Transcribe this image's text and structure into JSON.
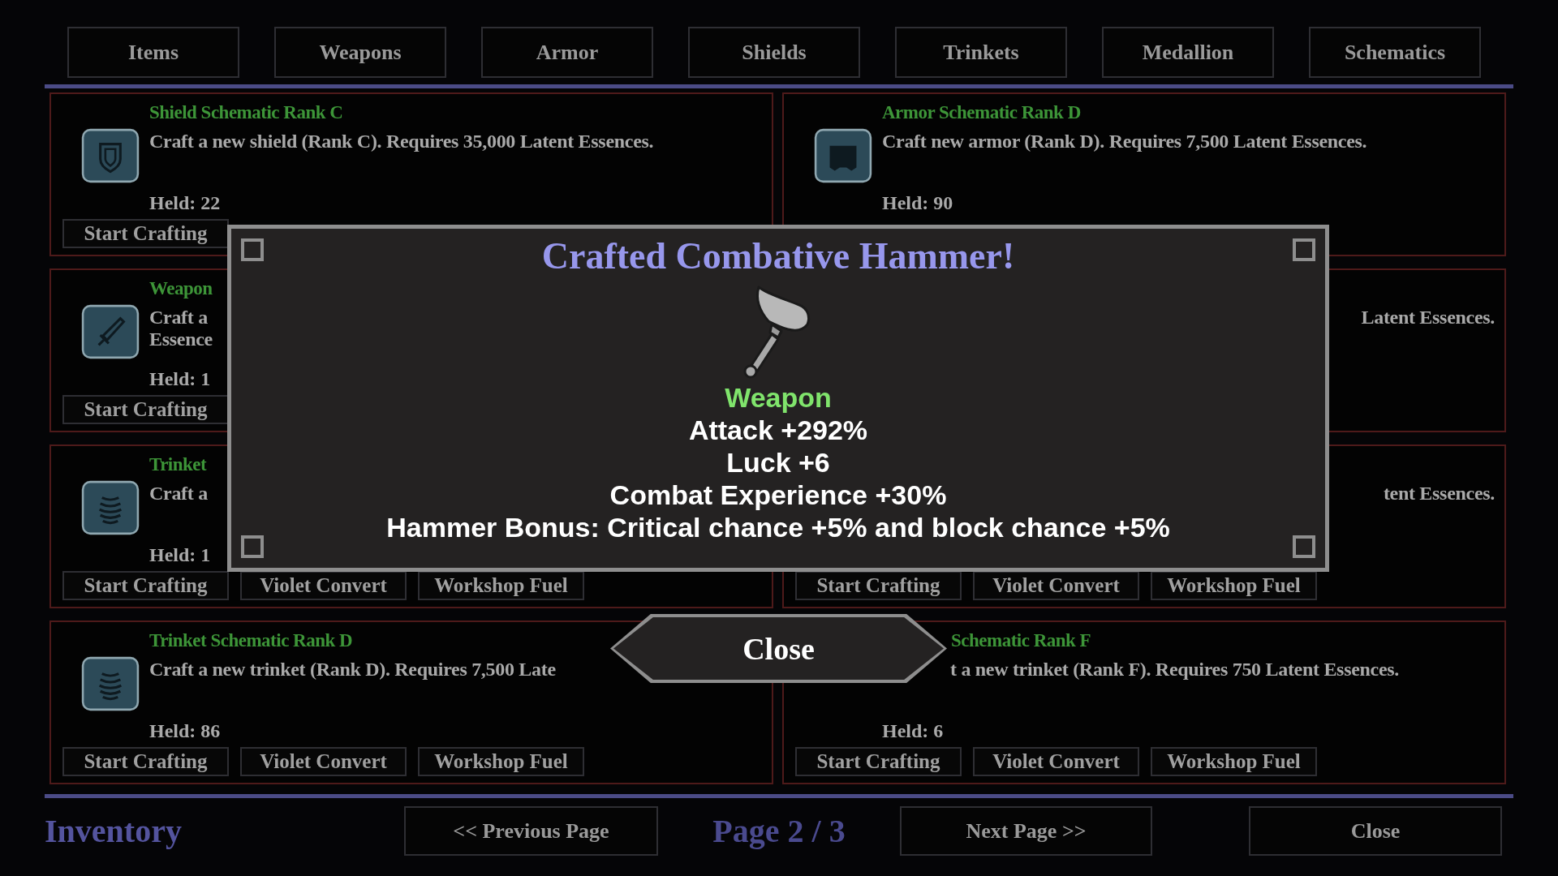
{
  "tabs": [
    {
      "label": "Items"
    },
    {
      "label": "Weapons"
    },
    {
      "label": "Armor"
    },
    {
      "label": "Shields"
    },
    {
      "label": "Trinkets"
    },
    {
      "label": "Medallion"
    },
    {
      "label": "Schematics"
    }
  ],
  "cards": [
    {
      "kind": "shield",
      "title": "Shield Schematic Rank C",
      "description": [
        "Craft a new shield (Rank C). Requires 35,000 Latent Essences."
      ],
      "held": "Held: 22",
      "buttons": [
        "Start Crafting"
      ]
    },
    {
      "kind": "armor",
      "title": "Armor Schematic Rank D",
      "description": [
        "Craft new armor (Rank D). Requires 7,500 Latent Essences."
      ],
      "held": "Held: 90"
    },
    {
      "kind": "sword",
      "title": "Weapon",
      "description": [
        "Craft a",
        "Essence"
      ],
      "held": "Held: 1",
      "buttons": [
        "Start Crafting"
      ]
    },
    {
      "description": [
        "Latent Essences."
      ]
    },
    {
      "kind": "coil",
      "title": "Trinket",
      "description": [
        "Craft a"
      ],
      "held": "Held: 1",
      "buttons": [
        "Start Crafting",
        "Violet Convert",
        "Workshop Fuel"
      ]
    },
    {
      "description": [
        "tent Essences."
      ],
      "buttons": [
        "Start Crafting",
        "Violet Convert",
        "Workshop Fuel"
      ]
    },
    {
      "kind": "coil",
      "title": "Trinket Schematic Rank D",
      "description": [
        "Craft a new trinket (Rank D). Requires 7,500 Late"
      ],
      "held": "Held: 86",
      "buttons": [
        "Start Crafting",
        "Violet Convert",
        "Workshop Fuel"
      ]
    },
    {
      "title": "Schematic Rank F",
      "description": [
        "t a new trinket (Rank F). Requires 750 Latent Essences."
      ],
      "held": "Held: 6",
      "buttons": [
        "Start Crafting",
        "Violet Convert",
        "Workshop Fuel"
      ]
    }
  ],
  "footer": {
    "title": "Inventory",
    "previous": "<< Previous Page",
    "page": "Page 2 / 3",
    "next": "Next Page >>",
    "close": "Close"
  },
  "dialog": {
    "title": "Crafted Combative Hammer!",
    "category": "Weapon",
    "stats": [
      "Attack +292%",
      "Luck +6",
      "Combat Experience +30%",
      "Hammer Bonus: Critical chance +5% and block chance +5%"
    ],
    "close": "Close"
  }
}
